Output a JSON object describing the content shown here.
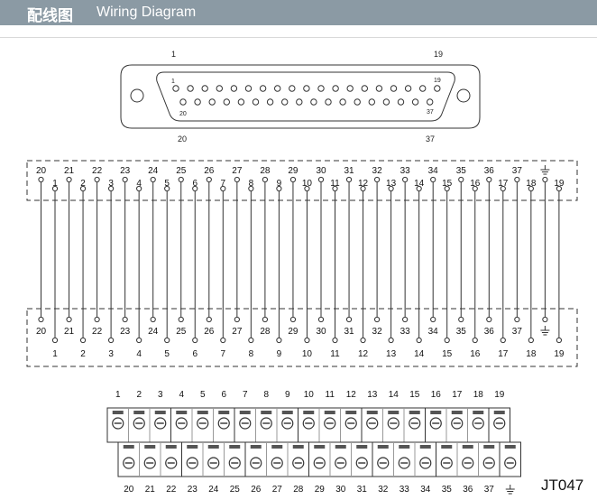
{
  "header": {
    "title_cn": "配线图",
    "title_en": "Wiring Diagram"
  },
  "connector": {
    "outer_labels": {
      "top_left": "1",
      "top_right": "19",
      "bottom_left": "20",
      "bottom_right": "37"
    },
    "inner_labels": {
      "top_left": "1",
      "top_right": "19",
      "bottom_left": "20",
      "bottom_right": "37"
    }
  },
  "pins": {
    "top_row": [
      "1",
      "2",
      "3",
      "4",
      "5",
      "6",
      "7",
      "8",
      "9",
      "10",
      "11",
      "12",
      "13",
      "14",
      "15",
      "16",
      "17",
      "18",
      "19"
    ],
    "bottom_row": [
      "20",
      "21",
      "22",
      "23",
      "24",
      "25",
      "26",
      "27",
      "28",
      "29",
      "30",
      "31",
      "32",
      "33",
      "34",
      "35",
      "36",
      "37"
    ]
  },
  "terminal_block": {
    "top_labels": [
      "1",
      "2",
      "3",
      "4",
      "5",
      "6",
      "7",
      "8",
      "9",
      "10",
      "11",
      "12",
      "13",
      "14",
      "15",
      "16",
      "17",
      "18",
      "19"
    ],
    "bottom_labels": [
      "20",
      "21",
      "22",
      "23",
      "24",
      "25",
      "26",
      "27",
      "28",
      "29",
      "30",
      "31",
      "32",
      "33",
      "34",
      "35",
      "36",
      "37"
    ]
  },
  "symbols": {
    "ground": "ground-icon"
  },
  "model": "JT047",
  "colors": {
    "header_bg": "#8b9aa4",
    "line": "#333333",
    "screw": "#444444"
  }
}
